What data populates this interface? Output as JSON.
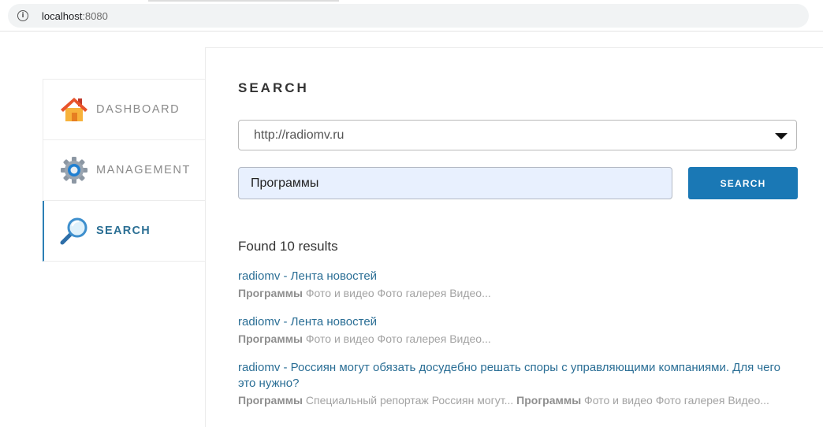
{
  "browser": {
    "url_host": "localhost",
    "url_port": ":8080",
    "info_glyph": "i"
  },
  "sidebar": {
    "items": [
      {
        "label": "DASHBOARD",
        "icon": "house-icon",
        "active": false
      },
      {
        "label": "MANAGEMENT",
        "icon": "gear-icon",
        "active": false
      },
      {
        "label": "SEARCH",
        "icon": "magnifier-icon",
        "active": true
      }
    ]
  },
  "main": {
    "title": "SEARCH",
    "site_select": {
      "value": "http://radiomv.ru"
    },
    "query": {
      "value": "Программы"
    },
    "search_button_label": "SEARCH",
    "found_text": "Found 10 results",
    "results": [
      {
        "title": "radiomv - Лента новостей",
        "snippet_bold_1": "Программы",
        "snippet_text_1": " Фото и видео Фото галерея Видео...",
        "snippet_bold_2": "",
        "snippet_text_2": ""
      },
      {
        "title": "radiomv - Лента новостей",
        "snippet_bold_1": "Программы",
        "snippet_text_1": " Фото и видео Фото галерея Видео...",
        "snippet_bold_2": "",
        "snippet_text_2": ""
      },
      {
        "title": "radiomv - Россиян могут обязать досудебно решать споры с управляющими компаниями. Для чего это нужно?",
        "snippet_bold_1": "Программы",
        "snippet_text_1": " Специальный репортаж Россиян могут... ",
        "snippet_bold_2": "Программы",
        "snippet_text_2": " Фото и видео Фото галерея Видео..."
      }
    ]
  },
  "colors": {
    "accent": "#1a78b5",
    "link": "#2a6e95",
    "snippet": "#a3a3a3"
  }
}
